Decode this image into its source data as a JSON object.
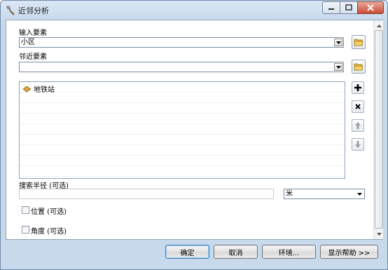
{
  "window": {
    "title": "近邻分析",
    "title_icon": "hammer-icon"
  },
  "form": {
    "input_features_label": "输入要素",
    "input_features_value": "小区",
    "near_features_label": "邻近要素",
    "near_features_value": "",
    "near_list": [
      {
        "label": "地铁站",
        "icon": "feature-layer-icon"
      }
    ],
    "search_radius_label": "搜索半径 (可选)",
    "search_radius_value": "",
    "search_radius_unit": "米",
    "location_label": "位置 (可选)",
    "location_checked": false,
    "angle_label": "角度 (可选)",
    "angle_checked": false
  },
  "buttons": {
    "ok": "确定",
    "cancel": "取消",
    "environments": "环境...",
    "show_help": "显示帮助 >>"
  },
  "colors": {
    "accent": "#3c7fb1",
    "folder": "#e7b736",
    "feature_icon": "#d9a441"
  }
}
